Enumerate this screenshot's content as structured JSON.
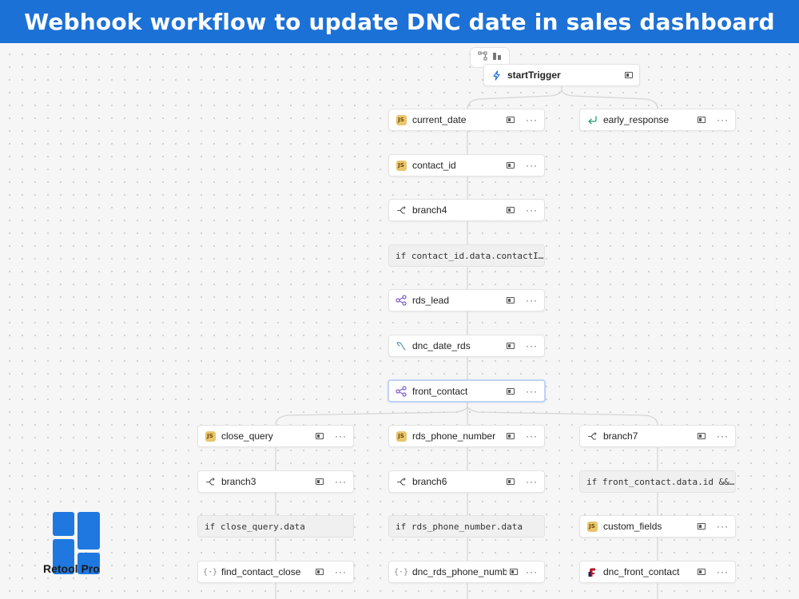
{
  "banner": {
    "title": "Webhook workflow to update DNC date in sales dashboard"
  },
  "colors": {
    "banner_bg": "#1c71d6",
    "js_badge": "#e9c56e",
    "resource_purple": "#7b5cc9",
    "selected_border": "#bfd3f5",
    "logo_blue": "#1f78e0"
  },
  "toolbar": {
    "icons": [
      "graph-layout-icon",
      "chart-bars-icon"
    ]
  },
  "nodes": {
    "start_trigger": {
      "label": "startTrigger",
      "icon": "lightning-icon"
    },
    "current_date": {
      "label": "current_date",
      "icon": "js-icon",
      "badge": "JS"
    },
    "early_response": {
      "label": "early_response",
      "icon": "return-arrow-icon"
    },
    "contact_id": {
      "label": "contact_id",
      "icon": "js-icon",
      "badge": "JS"
    },
    "branch4": {
      "label": "branch4",
      "icon": "branch-icon"
    },
    "branch4_cond": {
      "label": "if contact_id.data.contactI…"
    },
    "rds_lead": {
      "label": "rds_lead",
      "icon": "share-nodes-icon"
    },
    "dnc_date_rds": {
      "label": "dnc_date_rds",
      "icon": "mysql-dolphin-icon"
    },
    "front_contact": {
      "label": "front_contact",
      "icon": "share-nodes-icon"
    },
    "close_query": {
      "label": "close_query",
      "icon": "js-icon",
      "badge": "JS"
    },
    "rds_phone_number": {
      "label": "rds_phone_number",
      "icon": "js-icon",
      "badge": "JS"
    },
    "branch7": {
      "label": "branch7",
      "icon": "branch-icon"
    },
    "branch3": {
      "label": "branch3",
      "icon": "branch-icon"
    },
    "branch6": {
      "label": "branch6",
      "icon": "branch-icon"
    },
    "branch7_cond": {
      "label": "if front_contact.data.id &&…"
    },
    "branch3_cond": {
      "label": "if close_query.data"
    },
    "branch6_cond": {
      "label": "if rds_phone_number.data"
    },
    "custom_fields": {
      "label": "custom_fields",
      "icon": "js-icon",
      "badge": "JS"
    },
    "find_contact_close": {
      "label": "find_contact_close",
      "icon": "curly-braces-icon"
    },
    "dnc_rds_phone_number": {
      "label": "dnc_rds_phone_number",
      "icon": "curly-braces-icon"
    },
    "dnc_front_contact": {
      "label": "dnc_front_contact",
      "icon": "front-app-icon"
    }
  },
  "branding": {
    "logo_text": "Retool Pro"
  }
}
